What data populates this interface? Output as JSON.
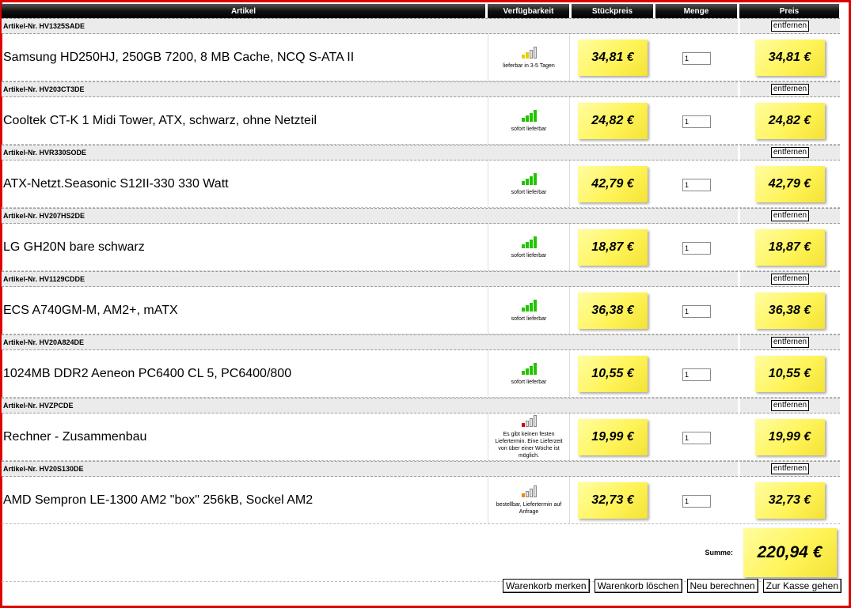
{
  "header": {
    "artikel": "Artikel",
    "availability": "Verfügbarkeit",
    "unit_price": "Stückpreis",
    "quantity": "Menge",
    "price": "Preis"
  },
  "remove_label": "entfernen",
  "items": [
    {
      "artnr": "Artikel-Nr. HV1325SADE",
      "name": "Samsung HD250HJ, 250GB 7200, 8 MB Cache, NCQ S-ATA II",
      "availability": "lieferbar in 3-5 Tagen",
      "level": 2,
      "color": "#e8d000",
      "unit_price": "34,81 €",
      "qty": "1",
      "total": "34,81 €"
    },
    {
      "artnr": "Artikel-Nr. HV203CT3DE",
      "name": "Cooltek CT-K 1 Midi Tower, ATX, schwarz, ohne Netzteil",
      "availability": "sofort lieferbar",
      "level": 4,
      "color": "#22c400",
      "unit_price": "24,82 €",
      "qty": "1",
      "total": "24,82 €"
    },
    {
      "artnr": "Artikel-Nr. HVR330SODE",
      "name": "ATX-Netzt.Seasonic S12II-330 330 Watt",
      "availability": "sofort lieferbar",
      "level": 4,
      "color": "#22c400",
      "unit_price": "42,79 €",
      "qty": "1",
      "total": "42,79 €"
    },
    {
      "artnr": "Artikel-Nr. HV207HS2DE",
      "name": "LG GH20N bare schwarz",
      "availability": "sofort lieferbar",
      "level": 4,
      "color": "#22c400",
      "unit_price": "18,87 €",
      "qty": "1",
      "total": "18,87 €"
    },
    {
      "artnr": "Artikel-Nr. HV1129CDDE",
      "name": "ECS A740GM-M, AM2+, mATX",
      "availability": "sofort lieferbar",
      "level": 4,
      "color": "#22c400",
      "unit_price": "36,38 €",
      "qty": "1",
      "total": "36,38 €"
    },
    {
      "artnr": "Artikel-Nr. HV20A824DE",
      "name": "1024MB DDR2 Aeneon PC6400 CL 5, PC6400/800",
      "availability": "sofort lieferbar",
      "level": 4,
      "color": "#22c400",
      "unit_price": "10,55 €",
      "qty": "1",
      "total": "10,55 €"
    },
    {
      "artnr": "Artikel-Nr. HVZPCDE",
      "name": "Rechner - Zusammenbau",
      "availability": "Es gibt keinen festen Liefertermin. Eine Lieferzeit von über einer Woche ist möglich.",
      "level": 1,
      "color": "#d80000",
      "unit_price": "19,99 €",
      "qty": "1",
      "total": "19,99 €"
    },
    {
      "artnr": "Artikel-Nr. HV20S130DE",
      "name": "AMD Sempron LE-1300 AM2 \"box\" 256kB, Sockel AM2",
      "availability": "bestellbar, Liefertermin auf Anfrage",
      "level": 1,
      "color": "#f08a00",
      "unit_price": "32,73 €",
      "qty": "1",
      "total": "32,73 €"
    }
  ],
  "summary": {
    "label": "Summe:",
    "total": "220,94 €"
  },
  "actions": {
    "save": "Warenkorb merken",
    "clear": "Warenkorb löschen",
    "recalc": "Neu berechnen",
    "checkout": "Zur Kasse gehen"
  },
  "colors": {
    "frame": "#e00000",
    "sticky": "#fff45a"
  }
}
